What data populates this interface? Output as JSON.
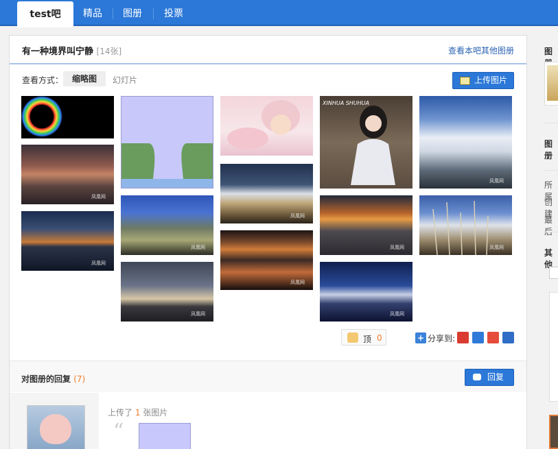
{
  "nav": {
    "active": "test吧",
    "tabs": [
      "精品",
      "图册",
      "投票"
    ]
  },
  "album": {
    "title": "有一种境界叫宁静",
    "count": "[14张]",
    "other_link": "查看本吧其他图册",
    "view_label": "查看方式：",
    "view_thumbnail": "缩略图",
    "view_slideshow": "幻灯片",
    "upload_label": "上传图片",
    "watermark": "凤凰网"
  },
  "photos": [
    {
      "name": "photo-eclipse",
      "desc": "eclipse"
    },
    {
      "name": "photo-placeholder",
      "desc": "placeholder"
    },
    {
      "name": "photo-girl-pink",
      "desc": "girl in pink"
    },
    {
      "name": "photo-girl-chair",
      "desc": "girl on chair",
      "label": "XINHUA SHUHUA"
    },
    {
      "name": "photo-snow-mountain",
      "desc": "snow mountain"
    },
    {
      "name": "photo-dusk-clouds",
      "desc": "dusk clouds"
    },
    {
      "name": "photo-blue-mountain",
      "desc": "blue mountain"
    },
    {
      "name": "photo-night-plain",
      "desc": "night plain"
    },
    {
      "name": "photo-orange-clouds",
      "desc": "orange clouds"
    },
    {
      "name": "photo-prayer-flags",
      "desc": "prayer flags"
    },
    {
      "name": "photo-sunset-lake",
      "desc": "sunset lake"
    },
    {
      "name": "photo-storm-clouds",
      "desc": "storm clouds"
    },
    {
      "name": "photo-red-lake",
      "desc": "red lake"
    },
    {
      "name": "photo-night-mountain",
      "desc": "night mountain"
    }
  ],
  "actions": {
    "like_label": "顶",
    "like_count": "0",
    "share_label": "分享到:"
  },
  "replies": {
    "title": "对图册的回复",
    "count": "(7)",
    "reply_button": "回复",
    "item_prefix": "上传了",
    "item_count": "1",
    "item_suffix": "张图片"
  },
  "sidebar": {
    "labels": [
      "图册",
      "图册",
      "所属",
      "创建",
      "最后",
      "其他"
    ]
  },
  "colors": {
    "nav": "#2b78d8",
    "accent": "#f07b27",
    "link": "#2d64b3"
  }
}
